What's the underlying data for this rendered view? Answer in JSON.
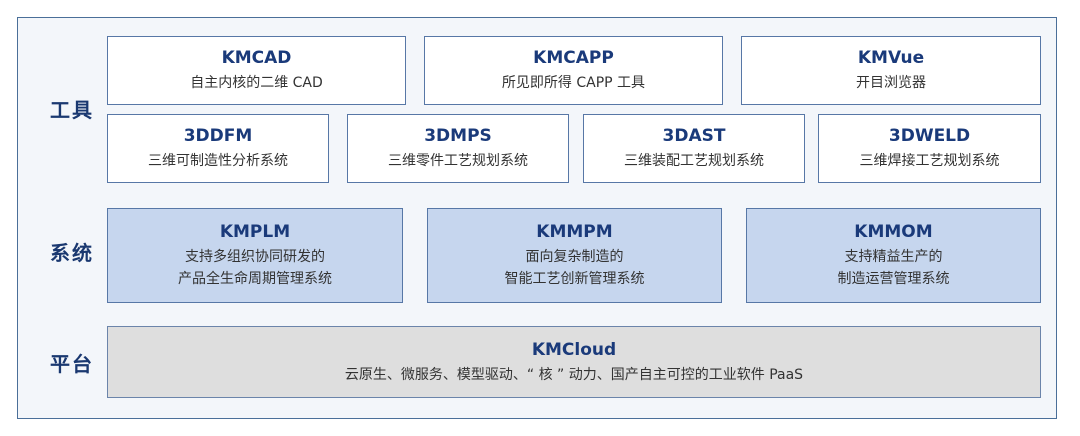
{
  "labels": {
    "tools": "工具",
    "systems": "系统",
    "platform": "平台"
  },
  "tools_row1": [
    {
      "title": "KMCAD",
      "desc": "自主内核的二维 CAD"
    },
    {
      "title": "KMCAPP",
      "desc": "所见即所得 CAPP 工具"
    },
    {
      "title": "KMVue",
      "desc": "开目浏览器"
    }
  ],
  "tools_row2": [
    {
      "title": "3DDFM",
      "desc": "三维可制造性分析系统"
    },
    {
      "title": "3DMPS",
      "desc": "三维零件工艺规划系统"
    },
    {
      "title": "3DAST",
      "desc": "三维装配工艺规划系统"
    },
    {
      "title": "3DWELD",
      "desc": "三维焊接工艺规划系统"
    }
  ],
  "systems": [
    {
      "title": "KMPLM",
      "line1": "支持多组织协同研发的",
      "line2": "产品全生命周期管理系统"
    },
    {
      "title": "KMMPM",
      "line1": "面向复杂制造的",
      "line2": "智能工艺创新管理系统"
    },
    {
      "title": "KMMOM",
      "line1": "支持精益生产的",
      "line2": "制造运营管理系统"
    }
  ],
  "platform": {
    "title": "KMCloud",
    "desc": "云原生、微服务、模型驱动、“ 核 ” 动力、国产自主可控的工业软件 PaaS"
  },
  "colors": {
    "border": "#5777a6",
    "title_text": "#1a3a7a",
    "label_text": "#1a3870",
    "system_fill": "#c6d6ee",
    "platform_fill": "#dedede"
  }
}
